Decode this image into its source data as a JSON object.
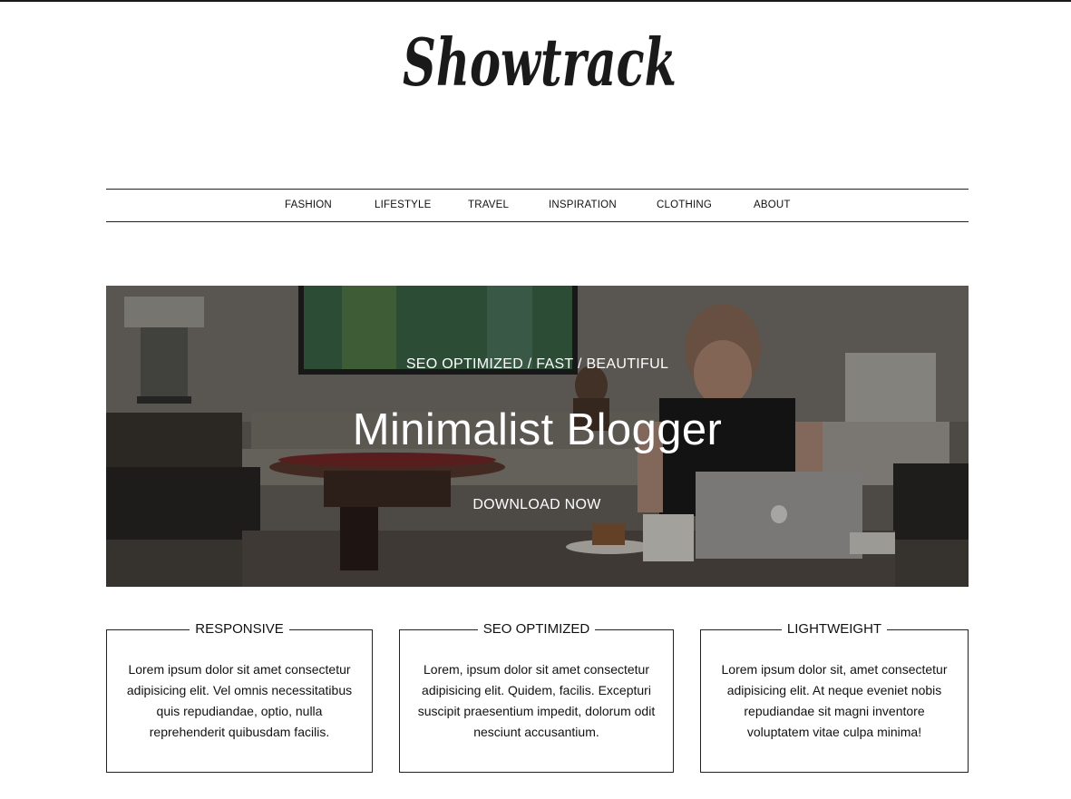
{
  "logo": {
    "text": "Showtrack"
  },
  "nav": {
    "items": [
      "FASHION",
      "LIFESTYLE",
      "TRAVEL",
      "INSPIRATION",
      "CLOTHING",
      "ABOUT"
    ]
  },
  "hero": {
    "tagline": "SEO OPTIMIZED / FAST / BEAUTIFUL",
    "title": "Minimalist Blogger",
    "cta": "DOWNLOAD NOW"
  },
  "features": [
    {
      "title": "RESPONSIVE",
      "text": "Lorem ipsum dolor sit amet consectetur adipisicing elit. Vel omnis necessitatibus quis repudiandae, optio, nulla reprehenderit quibusdam facilis."
    },
    {
      "title": "SEO OPTIMIZED",
      "text": "Lorem, ipsum dolor sit amet consectetur adipisicing elit. Quidem, facilis. Excepturi suscipit praesentium impedit, dolorum odit nesciunt accusantium."
    },
    {
      "title": "LIGHTWEIGHT",
      "text": "Lorem ipsum dolor sit, amet consectetur adipisicing elit. At neque eveniet nobis repudiandae sit magni inventore voluptatem vitae culpa minima!"
    }
  ]
}
